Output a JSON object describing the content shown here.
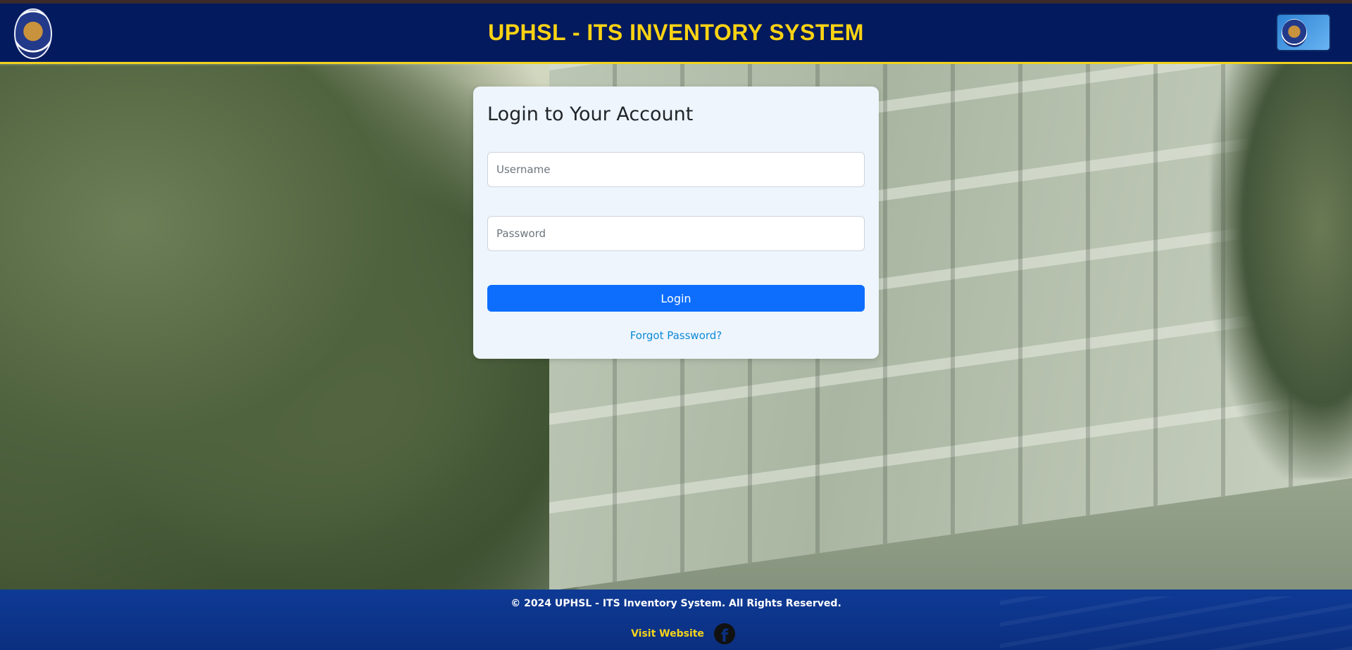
{
  "header": {
    "title": "UPHSL - ITS INVENTORY SYSTEM",
    "left_logo": "university-seal-logo",
    "right_logo": "its-monitor-logo"
  },
  "login": {
    "heading": "Login to Your Account",
    "username_placeholder": "Username",
    "username_value": "",
    "password_placeholder": "Password",
    "password_value": "",
    "button_label": "Login",
    "forgot_label": "Forgot Password?"
  },
  "footer": {
    "copyright": "© 2024 UPHSL - ITS Inventory System. All Rights Reserved.",
    "visit_label": "Visit Website",
    "social_icon": "facebook-icon"
  },
  "colors": {
    "header_bg": "#031a5e",
    "header_text": "#fbd313",
    "primary_button": "#0d6efd",
    "link": "#0d8ad6",
    "footer_bg": "#0e3a95"
  }
}
